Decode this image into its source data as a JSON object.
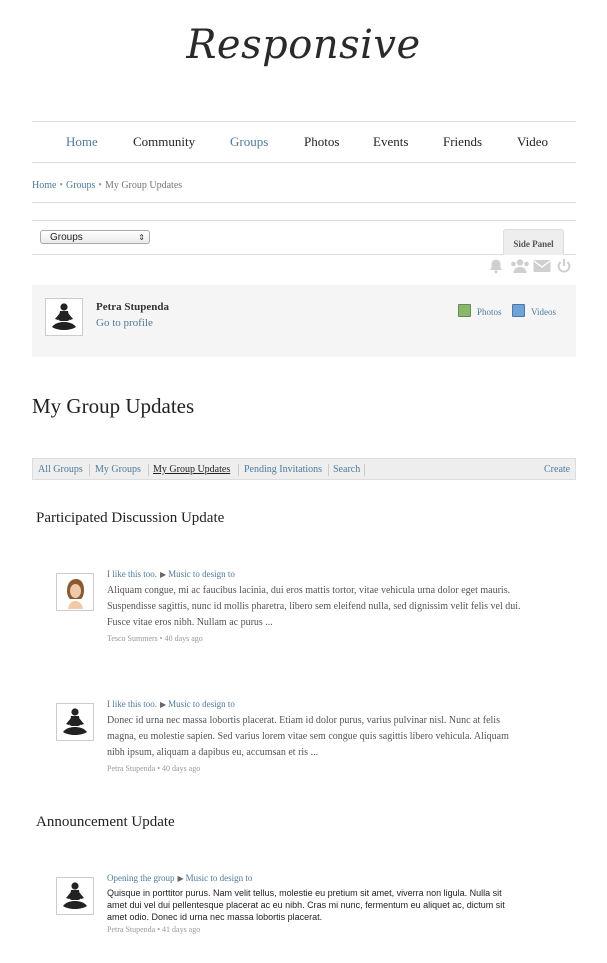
{
  "site": {
    "logo": "Responsive"
  },
  "nav": [
    "Home",
    "Community",
    "Groups",
    "Photos",
    "Events",
    "Friends",
    "Video"
  ],
  "breadcrumb": [
    "Home",
    "Groups",
    "My Group Updates"
  ],
  "toolbar": {
    "select_value": "Groups",
    "side_panel_label": "Side Panel",
    "icons": [
      "bell-icon",
      "users-icon",
      "mail-icon",
      "power-icon"
    ]
  },
  "profile": {
    "name": "Petra Stupenda",
    "link": "Go to profile",
    "photos_label": "Photos",
    "videos_label": "Videos"
  },
  "page_title": "My Group Updates",
  "subnav": {
    "tabs": [
      "All Groups",
      "My Groups",
      "My Group Updates",
      "Pending Invitations",
      "Search"
    ],
    "create": "Create"
  },
  "sections": [
    {
      "heading": "Participated Discussion Update",
      "items": [
        {
          "action": "I like this too.",
          "target": "Music to design to",
          "body": "Aliquam congue, mi ac faucibus lacinia, dui eros mattis tortor, vitae vehicula urna dolor eget mauris. Suspendisse sagittis, nunc id mollis pharetra, libero sem eleifend nulla, sed dignissim velit felis vel dui. Fusce vitae eros nibh. Nullam ac purus ...",
          "meta": "Tesco Summers • 40 days ago",
          "avatar": "woman-photo"
        },
        {
          "action": "I like this too.",
          "target": "Music to design to",
          "body": "Donec id urna nec massa lobortis placerat. Etiam id dolor purus, varius pulvinar nisl. Nunc at felis magna, eu molestie sapien. Sed varius lorem vitae sem congue quis sagittis libero vehicula. Aliquam nibh ipsum, aliquam a dapibus eu, accumsan et ris ...",
          "meta": "Petra Stupenda • 40 days ago",
          "avatar": "yoga-silhouette"
        }
      ]
    },
    {
      "heading": "Announcement Update",
      "items": [
        {
          "action": "Opening the group",
          "target": "Music to design to",
          "body": "Quisque in porttitor purus. Nam velit tellus, molestie eu pretium sit amet, viverra non ligula. Nulla sit amet dui vel dui pellentesque placerat ac eu nibh. Cras mi nunc, fermentum eu aliquet ac, dictum sit amet odio. Donec id urna nec massa lobortis placerat.",
          "meta": "Petra Stupenda • 41 days ago",
          "avatar": "yoga-silhouette"
        }
      ]
    }
  ]
}
